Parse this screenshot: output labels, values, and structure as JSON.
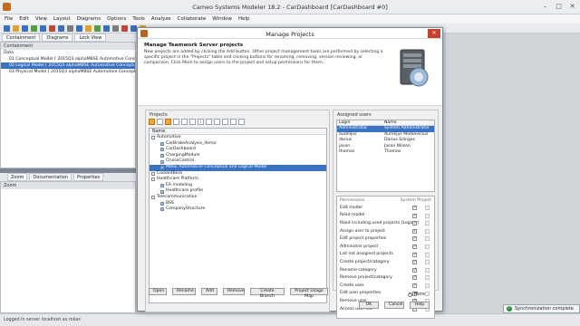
{
  "window": {
    "title": "Cameo Systems Modeler 18.2 - CarDashboard [CarDashboard #0]"
  },
  "menu": [
    "File",
    "Edit",
    "View",
    "Layout",
    "Diagrams",
    "Options",
    "Tools",
    "Analyze",
    "Collaborate",
    "Window",
    "Help"
  ],
  "top_tabs": [
    "Containment",
    "Diagrams",
    "Lock View"
  ],
  "containment": {
    "header": "Containment",
    "items": [
      {
        "label": "Data",
        "selected": false
      },
      {
        "label": "01 Conceptual Model [ 2015Q3 alphaMBSE Automotive Conceptual and",
        "selected": false
      },
      {
        "label": "02 Logical Model [ 2015Q3 alphaMBSE Automotive Conceptual and",
        "selected": true
      },
      {
        "label": "03 Physical Model [ 2015Q3 alphaMBSE Automotive Conceptual and",
        "selected": false
      }
    ]
  },
  "bottom_tabs": [
    "Zoom",
    "Documentation",
    "Properties"
  ],
  "zoom_panel": {
    "header": "Zoom"
  },
  "status": {
    "text": "Logged in server localhost as rokas"
  },
  "dialog": {
    "title": "Manage Projects",
    "heading": "Manage Teamwork Server projects",
    "description": "New projects are added by clicking the Add button. Other project management tasks are performed by selecting a specific project in the \"Projects\" table and clicking buttons for renaming, removing, version reviewing, or comparison. Click More to assign users to the project and setup permissions for them.",
    "projects_label": "Projects",
    "name_col": "Name",
    "projects": [
      {
        "label": "Automotive",
        "kind": "group",
        "selected": false
      },
      {
        "label": "CarBrakeAnalysis_demo",
        "kind": "item",
        "selected": false
      },
      {
        "label": "CarDashboard",
        "kind": "item",
        "selected": false
      },
      {
        "label": "ChargingModule",
        "kind": "item",
        "selected": false
      },
      {
        "label": "CruiseControl",
        "kind": "item",
        "selected": false
      },
      {
        "label": "MBSE Automotive Conceptual and Logical Model",
        "kind": "item",
        "selected": true
      },
      {
        "label": "CoolantBoro",
        "kind": "group",
        "selected": false
      },
      {
        "label": "Healthcare Platform",
        "kind": "group",
        "selected": false
      },
      {
        "label": "EA modeling",
        "kind": "item",
        "selected": false
      },
      {
        "label": "Healthcare profile",
        "kind": "item",
        "selected": false
      },
      {
        "label": "Telecommunication",
        "kind": "group",
        "selected": false
      },
      {
        "label": "BSS",
        "kind": "item",
        "selected": false
      },
      {
        "label": "CompanyStructure",
        "kind": "item",
        "selected": false
      }
    ],
    "project_buttons": [
      "Open",
      "Rename",
      "Add",
      "Remove",
      "Create Branch",
      "Project Usage Map"
    ],
    "assigned_label": "Assigned users",
    "user_cols": [
      "Login",
      "Name"
    ],
    "users": [
      {
        "login": "Administrator",
        "name": "System Administrator",
        "selected": true
      },
      {
        "login": "aurelijus",
        "name": "Aurelijus Morkevicius",
        "selected": false
      },
      {
        "login": "darius",
        "name": "Darius Silingas",
        "selected": false
      },
      {
        "login": "jason",
        "name": "Jason Wilson",
        "selected": false
      },
      {
        "login": "thomas",
        "name": "Thomas",
        "selected": false
      }
    ],
    "permissions_label": "Permissions",
    "system_project_label": "System Project",
    "permissions": [
      {
        "label": "Edit model",
        "checked": true
      },
      {
        "label": "Read model",
        "checked": true
      },
      {
        "label": "Read including used projects (Legacy)",
        "checked": true
      },
      {
        "label": "Assign user to project",
        "checked": true
      },
      {
        "label": "Edit project properties",
        "checked": true
      },
      {
        "label": "Administer project",
        "checked": true
      },
      {
        "label": "List not assigned projects",
        "checked": true
      },
      {
        "label": "Create project/category",
        "checked": true
      },
      {
        "label": "Rename category",
        "checked": true
      },
      {
        "label": "Remove project/category",
        "checked": true
      },
      {
        "label": "Create user",
        "checked": true
      },
      {
        "label": "Edit user properties",
        "checked": true
      },
      {
        "label": "Remove user",
        "checked": true
      },
      {
        "label": "Access user list",
        "checked": true
      }
    ],
    "more_label": "More",
    "ok": "OK",
    "cancel": "Cancel",
    "help": "Help"
  },
  "toast": {
    "text": "Synchronization complete"
  },
  "colors": {
    "selection": "#3a72c4",
    "dialog_bg": "#f0f0f0",
    "close": "#c7412e"
  }
}
